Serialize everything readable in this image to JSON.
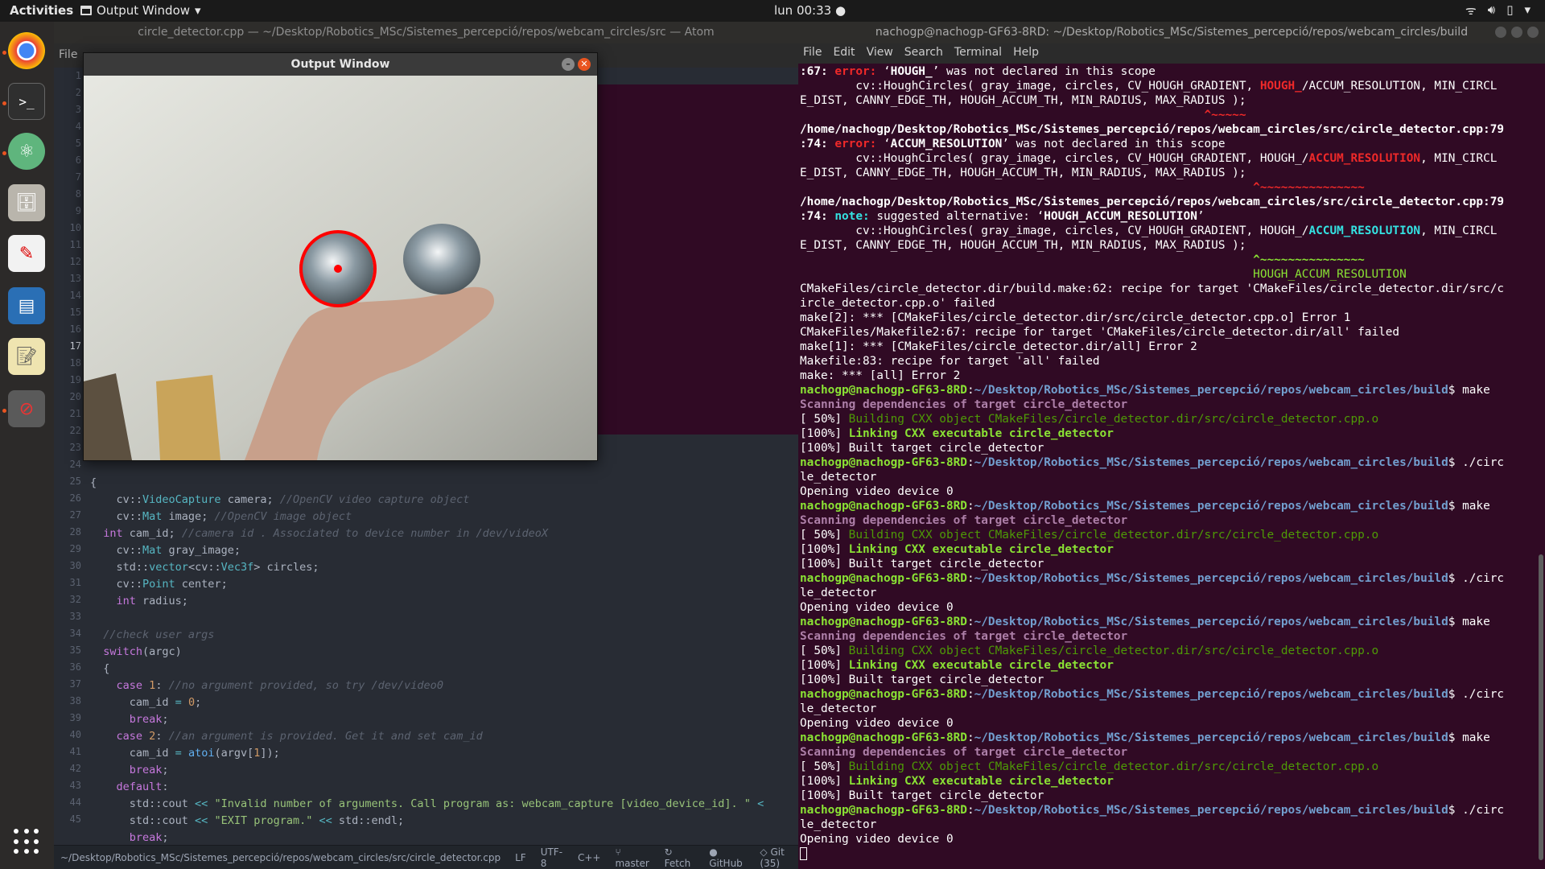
{
  "topbar": {
    "activities": "Activities",
    "app_name": "Output Window",
    "clock": "lun 00:33"
  },
  "dock": {
    "items": [
      "chrome-icon",
      "terminal-icon",
      "atom-icon",
      "files-icon",
      "pdf-icon",
      "writer-icon",
      "text-editor-icon",
      "blocked-icon"
    ]
  },
  "atom": {
    "title": "circle_detector.cpp — ~/Desktop/Robotics_MSc/Sistemes_percepció/repos/webcam_circles/src — Atom",
    "menu_first": "File",
    "line_numbers": [
      "1",
      "2",
      "3",
      "4",
      "5",
      "6",
      "7",
      "8",
      "9",
      "10",
      "11",
      "12",
      "13",
      "14",
      "15",
      "16",
      "17",
      "18",
      "19",
      "20",
      "21",
      "22",
      "23",
      "24",
      "25",
      "26",
      "27",
      "28",
      "29",
      "30",
      "31",
      "32",
      "33",
      "34",
      "35",
      "36",
      "37",
      "38",
      "39",
      "40",
      "41",
      "42",
      "43",
      "44",
      "45"
    ],
    "status": {
      "path": "~/Desktop/Robotics_MSc/Sistemes_percepció/repos/webcam_circles/src/circle_detector.cpp",
      "eol": "LF",
      "encoding": "UTF-8",
      "grammar": "C++",
      "branch": "master",
      "fetch": "Fetch",
      "github": "GitHub",
      "git": "Git (35)"
    }
  },
  "output_window": {
    "title": "Output Window"
  },
  "terminal": {
    "title": "nachogp@nachogp-GF63-8RD: ~/Desktop/Robotics_MSc/Sistemes_percepció/repos/webcam_circles/build",
    "menu": [
      "File",
      "Edit",
      "View",
      "Search",
      "Terminal",
      "Help"
    ]
  }
}
